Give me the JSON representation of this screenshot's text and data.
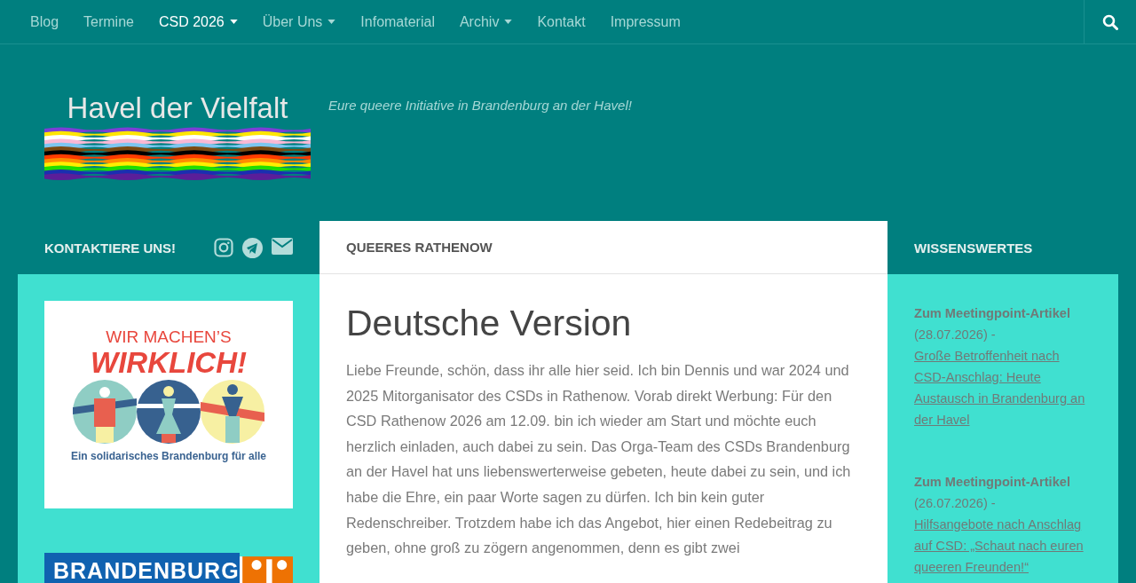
{
  "nav": {
    "items": [
      {
        "label": "Blog",
        "selected": false,
        "has_submenu": false
      },
      {
        "label": "Termine",
        "selected": false,
        "has_submenu": false
      },
      {
        "label": "CSD 2026",
        "selected": true,
        "has_submenu": true
      },
      {
        "label": "Über Uns",
        "selected": false,
        "has_submenu": true
      },
      {
        "label": "Infomaterial",
        "selected": false,
        "has_submenu": false
      },
      {
        "label": "Archiv",
        "selected": false,
        "has_submenu": true
      },
      {
        "label": "Kontakt",
        "selected": false,
        "has_submenu": false
      },
      {
        "label": "Impressum",
        "selected": false,
        "has_submenu": false
      }
    ]
  },
  "header": {
    "site_title": "Havel der Vielfalt",
    "tagline": "Eure queere Initiative in Brandenburg an der Havel!"
  },
  "left_sidebar": {
    "heading": "KONTAKTIERE UNS!",
    "banner": {
      "line_1": "WIR MACHEN’S",
      "line_2": "WIRKLICH!",
      "caption": "Ein solidarisches Brandenburg für alle"
    },
    "second_banner": {
      "text": "BRANDENBURG"
    }
  },
  "main": {
    "heading": "QUEERES RATHENOW",
    "title": "Deutsche Version",
    "paragraph": "Liebe Freunde, schön, dass ihr alle hier seid. Ich bin Dennis und war 2024 und 2025 Mitorganisator des CSDs in Rathenow. Vorab direkt Werbung: Für den CSD Rathenow 2026 am 12.09. bin ich wieder am Start und möchte euch herzlich einladen, auch dabei zu sein. Das Orga-Team des CSDs Brandenburg an der Havel hat uns liebenswerterweise gebeten, heute dabei zu sein, und ich habe die Ehre, ein paar Worte sagen zu dürfen. Ich bin kein guter Redenschreiber. Trotzdem habe ich das Angebot, hier einen Redebeitrag zu geben, ohne groß zu zögern angenommen, denn es gibt zwei"
  },
  "right_sidebar": {
    "heading": "WISSENSWERTES",
    "posts": [
      {
        "title": "Zum Meetingpoint-Artikel",
        "date": "(28.07.2026) -",
        "link": "Große Betroffenheit nach CSD-Anschlag: Heute Austausch in Brandenburg an der Havel"
      },
      {
        "title": "Zum Meetingpoint-Artikel",
        "date": "(26.07.2026) -",
        "link": "Hilfsangebote nach Anschlag auf CSD: „Schaut nach euren queeren Freunden!“"
      }
    ]
  }
}
